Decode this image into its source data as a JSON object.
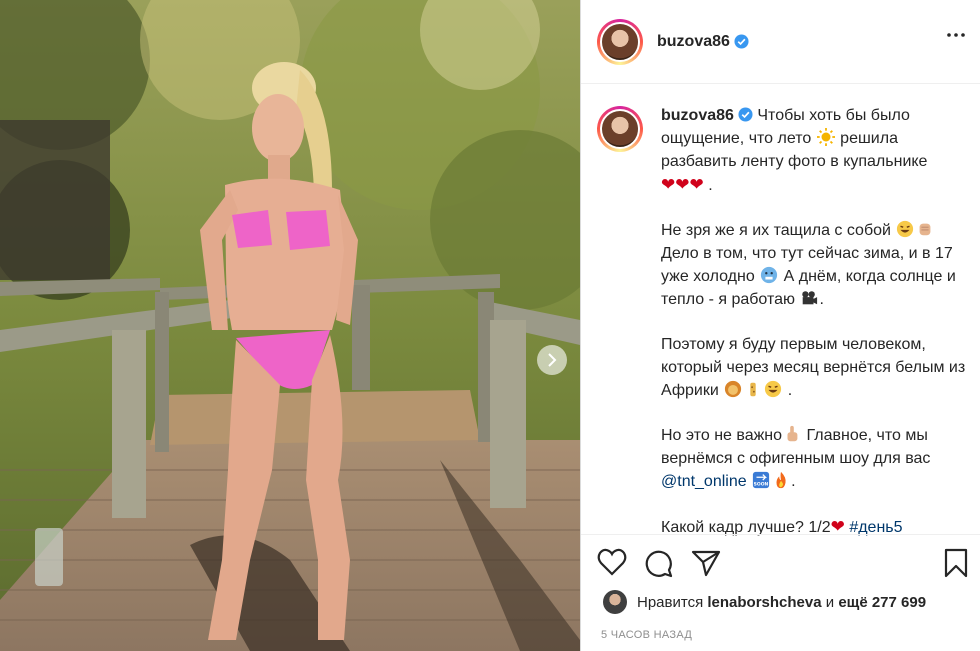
{
  "post": {
    "username": "buzova86",
    "caption": {
      "intro": "Чтобы хоть бы было ощущение, что лето",
      "intro2": "решила разбавить ленту фото в купальнике",
      "intro_hearts": "❤❤❤",
      "intro_end": ".",
      "p2a": "Не зря же я их тащила с собой",
      "p2b": "Дело в том, что тут сейчас зима, и в 17 уже холодно",
      "p2c": "А днём, когда солнце и тепло - я работаю",
      "p2d": ".",
      "p3a": "Поэтому я буду первым человеком, который через месяц вернётся белым из Африки",
      "p3b": ".",
      "p4a": "Но это не важно",
      "p4b": "Главное, что мы вернёмся с офигенным шоу для вас",
      "p4_mention": "@tnt_online",
      "p4c": ".",
      "p5a": "Какой кадр лучше? 1/2",
      "p5_heart": "❤",
      "p5_tag": "#день5"
    },
    "likes": {
      "prefix": "Нравится",
      "user": "lenaborshcheva",
      "connector": "и",
      "count": "ещё 277 699"
    },
    "time": "5 ЧАСОВ НАЗАД",
    "emoji_badge": "SOON"
  },
  "icons": {
    "verified": "verified-badge-icon",
    "more": "more-options-icon",
    "like": "heart-outline-icon",
    "comment": "comment-bubble-icon",
    "share": "paper-plane-icon",
    "save": "bookmark-icon",
    "next": "chevron-right-icon"
  },
  "colors": {
    "verified": "#3897f0",
    "link": "#00376b",
    "heart": "#d0021b",
    "muted": "#8e8e8e"
  }
}
